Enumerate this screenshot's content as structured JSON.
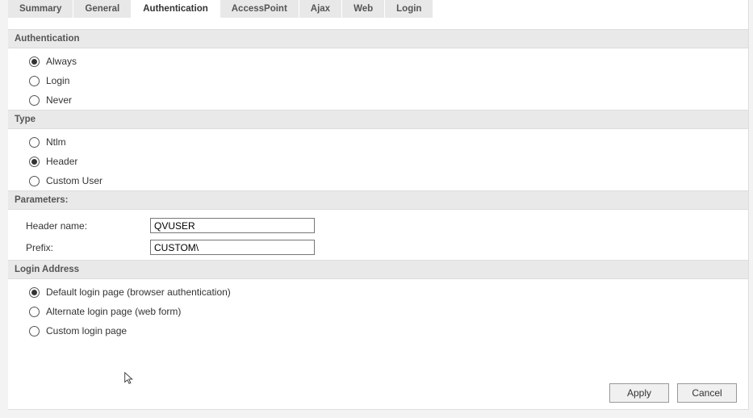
{
  "tabs": [
    {
      "label": "Summary",
      "active": false
    },
    {
      "label": "General",
      "active": false
    },
    {
      "label": "Authentication",
      "active": true
    },
    {
      "label": "AccessPoint",
      "active": false
    },
    {
      "label": "Ajax",
      "active": false
    },
    {
      "label": "Web",
      "active": false
    },
    {
      "label": "Login",
      "active": false
    }
  ],
  "sections": {
    "authentication": {
      "header": "Authentication",
      "options": [
        {
          "label": "Always",
          "selected": true
        },
        {
          "label": "Login",
          "selected": false
        },
        {
          "label": "Never",
          "selected": false
        }
      ]
    },
    "type": {
      "header": "Type",
      "options": [
        {
          "label": "Ntlm",
          "selected": false
        },
        {
          "label": "Header",
          "selected": true
        },
        {
          "label": "Custom User",
          "selected": false
        }
      ]
    },
    "parameters": {
      "header": "Parameters:",
      "fields": [
        {
          "label": "Header name:",
          "value": "QVUSER"
        },
        {
          "label": "Prefix:",
          "value": "CUSTOM\\"
        }
      ]
    },
    "loginAddress": {
      "header": "Login Address",
      "options": [
        {
          "label": "Default login page (browser authentication)",
          "selected": true
        },
        {
          "label": "Alternate login page (web form)",
          "selected": false
        },
        {
          "label": "Custom login page",
          "selected": false
        }
      ]
    }
  },
  "buttons": {
    "apply": "Apply",
    "cancel": "Cancel"
  }
}
